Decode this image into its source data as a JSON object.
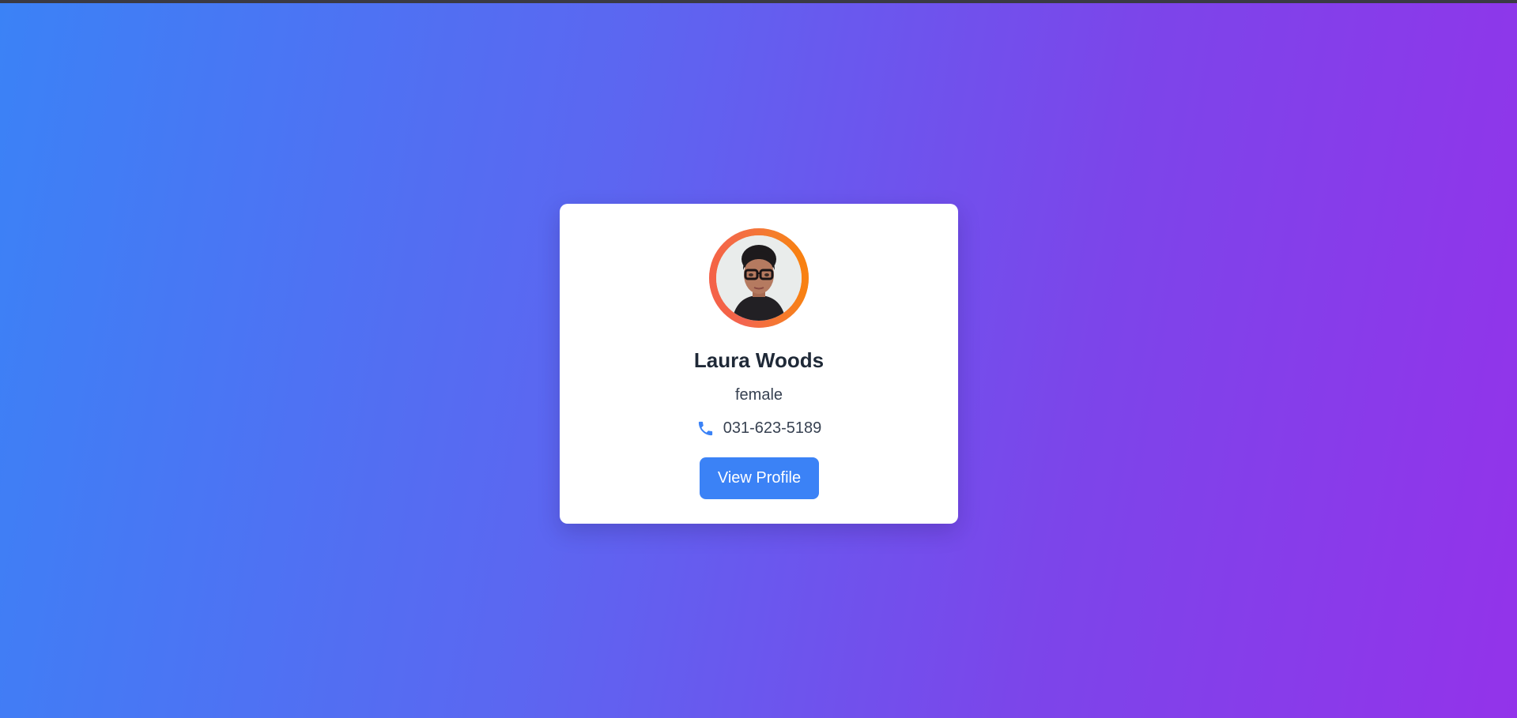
{
  "profile": {
    "name": "Laura Woods",
    "gender": "female",
    "phone": "031-623-5189",
    "button_label": "View Profile"
  },
  "icons": {
    "phone": "phone-icon"
  },
  "colors": {
    "background_start": "#3b82f6",
    "background_end": "#9333ea",
    "card": "#ffffff",
    "button": "#3b82f6",
    "phone_icon": "#3b82f6",
    "avatar_ring_start": "#ec4899",
    "avatar_ring_end": "#f59e0b"
  }
}
